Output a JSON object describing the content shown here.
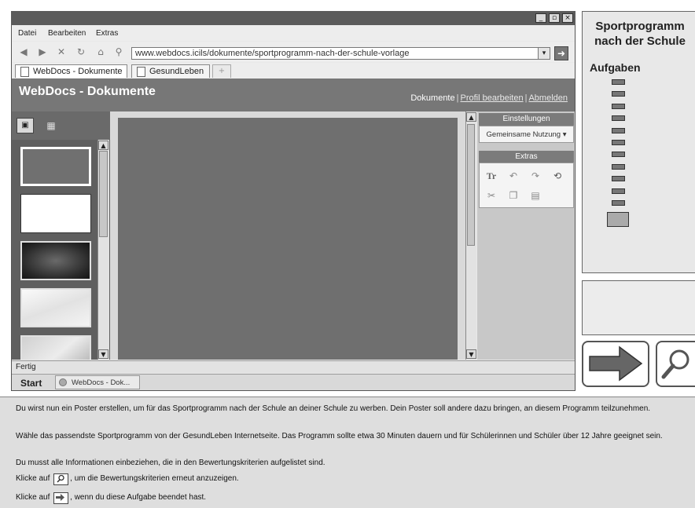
{
  "browser": {
    "window_controls": {
      "minimize": "_",
      "maximize": "▫",
      "close": "×"
    },
    "menu": [
      "Datei",
      "Bearbeiten",
      "Extras"
    ],
    "address": "www.webdocs.icils/dokumente/sportprogramm-nach-der-schule-vorlage",
    "tabs": [
      {
        "label": "WebDocs - Dokumente"
      },
      {
        "label": "GesundLeben"
      }
    ],
    "new_tab": "+",
    "status": "Fertig"
  },
  "app": {
    "title": "WebDocs - Dokumente",
    "links": {
      "documents": "Dokumente",
      "edit_profile": "Profil bearbeiten",
      "logout": "Abmelden",
      "sep": "|"
    },
    "settings": {
      "heading": "Einstellungen",
      "sharing": "Gemeinsame Nutzung ▾"
    },
    "extras": {
      "heading": "Extras"
    }
  },
  "taskbar": {
    "start": "Start",
    "item": "WebDocs - Dok..."
  },
  "task_panel": {
    "title": "Sportprogramm nach der Schule",
    "tasks_label": "Aufgaben",
    "task_count": 12,
    "current_task": 13
  },
  "instructions": {
    "p1": "Du wirst nun ein Poster erstellen, um für das Sportprogramm nach der Schule an deiner Schule zu werben. Dein Poster soll andere dazu bringen, an diesem Programm teilzunehmen.",
    "p2": "Wähle das passendste Sportprogramm von der GesundLeben Internetseite. Das Programm sollte etwa 30 Minuten dauern und für Schülerinnen und Schüler über 12 Jahre geeignet sein.",
    "p3": "Du musst alle Informationen einbeziehen, die in den Bewertungskriterien aufgelistet sind.",
    "p4_pre": "Klicke auf",
    "p4_post": ", um die Bewertungskriterien erneut anzuzeigen.",
    "p5_pre": "Klicke auf",
    "p5_post": ", wenn du diese Aufgabe beendet hast."
  }
}
